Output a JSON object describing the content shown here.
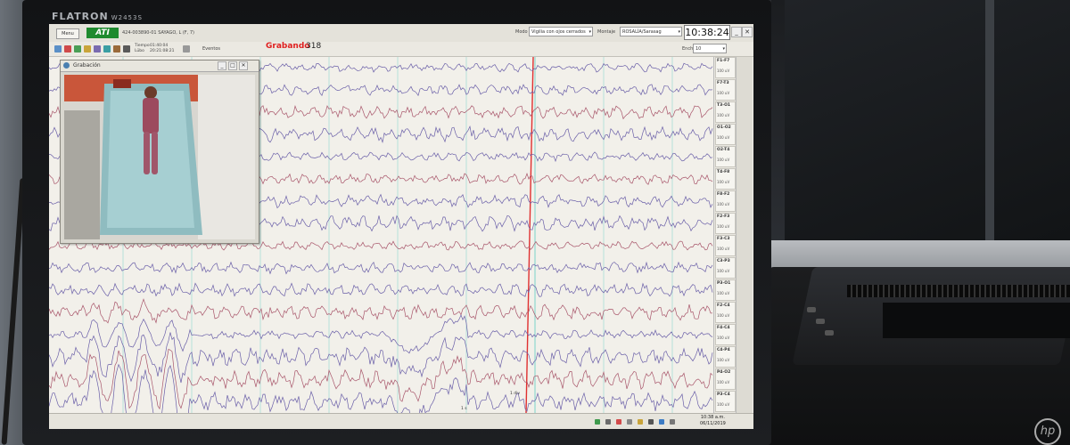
{
  "monitor": {
    "brand": "FLATRON",
    "model": "W2453S"
  },
  "app": {
    "menu_label": "Menu",
    "logo_text": "ATI",
    "patient": "424-003890-01 SAYAGO, L (F, 7)",
    "time_label": "Tiempo",
    "time_value": "01:40:04",
    "date_label": "Lübo",
    "date_value": "20:21:08:21",
    "events_label": "Eventos",
    "rec_label": "Grabando",
    "rec_count": "318",
    "mode_label": "Modo",
    "mode_value": "Vigilia con ojos cerrados",
    "montage_label": "Montaje",
    "montage_value": "ROSALÍA/Sarasag",
    "clock": "10:38:24",
    "sens_label": "Ench",
    "sens_value": "10"
  },
  "video": {
    "title": "Grabación"
  },
  "channels": [
    {
      "name": "F1-F7",
      "scale": "100 uV"
    },
    {
      "name": "F7-T3",
      "scale": "100 uV"
    },
    {
      "name": "T3-O1",
      "scale": "100 uV"
    },
    {
      "name": "O1-O2",
      "scale": "100 uV"
    },
    {
      "name": "O2-T4",
      "scale": "100 uV"
    },
    {
      "name": "T4-F8",
      "scale": "100 uV"
    },
    {
      "name": "F8-F2",
      "scale": "100 uV"
    },
    {
      "name": "F2-F3",
      "scale": "100 uV"
    },
    {
      "name": "F3-C3",
      "scale": "100 uV"
    },
    {
      "name": "C3-P3",
      "scale": "100 uV"
    },
    {
      "name": "P3-O1",
      "scale": "100 uV"
    },
    {
      "name": "F2-C4",
      "scale": "100 uV"
    },
    {
      "name": "F4-C4",
      "scale": "100 uV"
    },
    {
      "name": "C4-P4",
      "scale": "100 uV"
    },
    {
      "name": "P4-O2",
      "scale": "100 uV"
    },
    {
      "name": "P3-C4",
      "scale": "100 uV"
    }
  ],
  "markers": {
    "second_label": "1 s",
    "div_label": "1 div"
  },
  "taskbar": {
    "time": "10:38 a.m.",
    "date": "06/11/2019"
  },
  "colors": {
    "trace_blue": "#6a5fa8",
    "trace_red": "#a8556a",
    "grid_cyan": "#8fd8d0",
    "event_line": "#e03030",
    "rec": "#e02020"
  }
}
